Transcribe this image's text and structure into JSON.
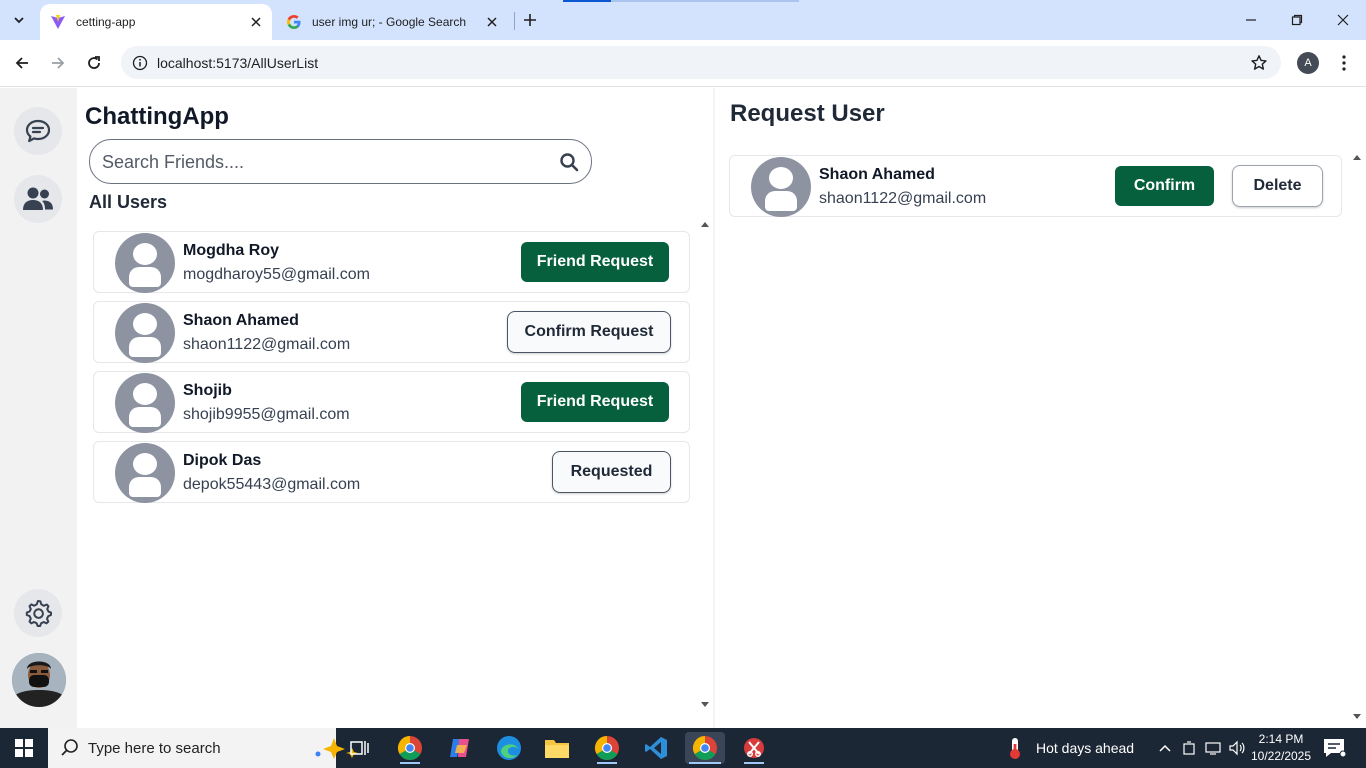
{
  "browser": {
    "tabs": [
      {
        "title": "cetting-app",
        "active": true
      },
      {
        "title": "user img ur; - Google Search",
        "active": false
      }
    ],
    "url": "localhost:5173/AllUserList",
    "profile_initial": "A"
  },
  "sidebar": {
    "items": [
      "chat-icon",
      "friends-icon"
    ],
    "bottom": [
      "settings-icon",
      "user-avatar"
    ]
  },
  "app": {
    "title": "ChattingApp",
    "search_placeholder": "Search Friends....",
    "all_users_title": "All Users",
    "users": [
      {
        "name": "Mogdha Roy",
        "email": "mogdharoy55@gmail.com",
        "action": "Friend Request",
        "style": "primary"
      },
      {
        "name": "Shaon Ahamed",
        "email": "shaon1122@gmail.com",
        "action": "Confirm Request",
        "style": "outline"
      },
      {
        "name": "Shojib",
        "email": "shojib9955@gmail.com",
        "action": "Friend Request",
        "style": "primary"
      },
      {
        "name": "Dipok Das",
        "email": "depok55443@gmail.com",
        "action": "Requested",
        "style": "outline"
      }
    ],
    "request_title": "Request User",
    "requests": [
      {
        "name": "Shaon Ahamed",
        "email": "shaon1122@gmail.com",
        "confirm_label": "Confirm",
        "delete_label": "Delete"
      }
    ],
    "colors": {
      "primary": "#06603e",
      "sidebar_bg": "#f2f2f2"
    }
  },
  "taskbar": {
    "search_text": "Type here to search",
    "weather": "Hot days ahead",
    "time": "2:14 PM",
    "date": "10/22/2025"
  }
}
